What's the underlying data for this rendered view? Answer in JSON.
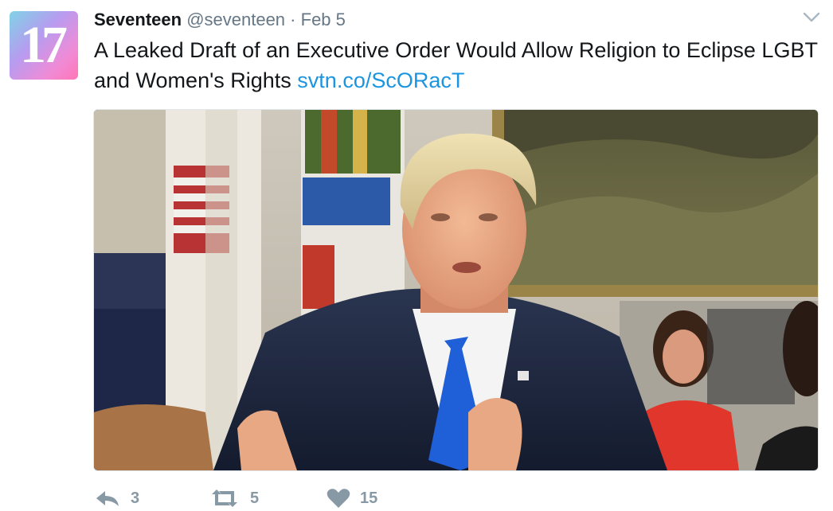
{
  "tweet": {
    "avatar_text": "17",
    "display_name": "Seventeen",
    "handle": "@seventeen",
    "separator": "·",
    "date": "Feb 5",
    "text": "A Leaked Draft of an Executive Order Would Allow Religion to Eclipse LGBT and Women's Rights",
    "link": "svtn.co/ScORacT",
    "media": {
      "description_icon": "photo-man-in-suit-blue-tie"
    },
    "actions": {
      "reply_count": "3",
      "retweet_count": "5",
      "like_count": "15"
    }
  },
  "colors": {
    "text": "#14171a",
    "secondary": "#657786",
    "link": "#1b95e0",
    "action_icon": "#8899a6"
  }
}
